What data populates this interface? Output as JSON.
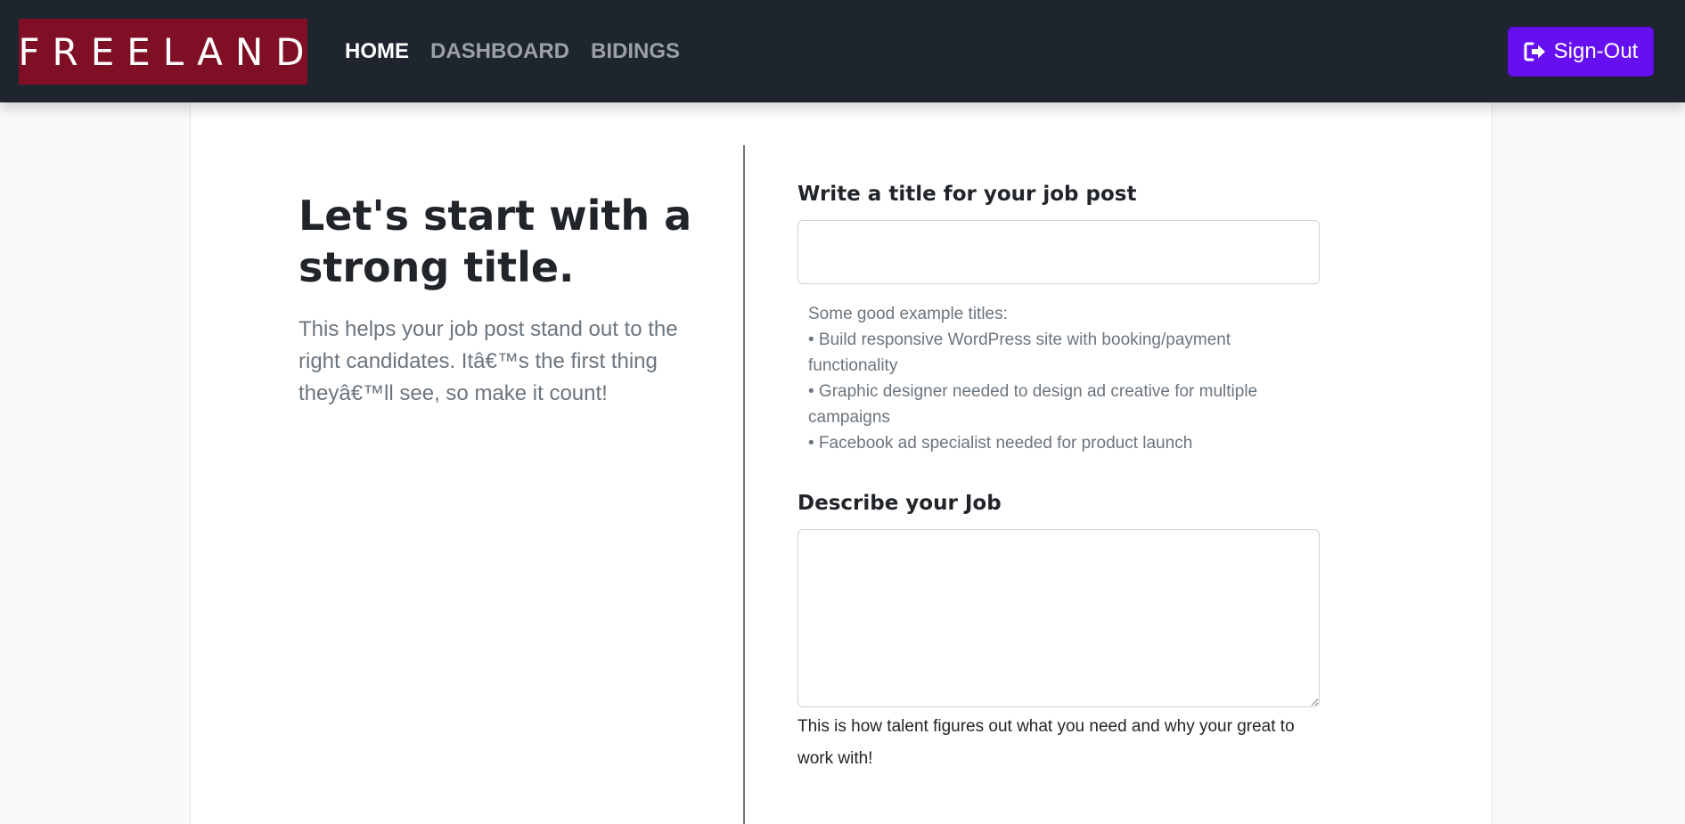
{
  "navbar": {
    "brand": "FREELAND",
    "links": [
      "HOME",
      "DASHBOARD",
      "BIDINGS"
    ],
    "signout_label": "Sign-Out",
    "colors": {
      "background": "#1e252e",
      "brand_bg": "#7f0f24",
      "signout_bg": "#6610f2"
    }
  },
  "intro": {
    "heading": "Let's start with a strong title.",
    "lead": "This helps your job post stand out to the right candidates. Itâ€™s the first thing theyâ€™ll see, so make it count!"
  },
  "form": {
    "title_label": "Write a title for your job post",
    "title_value": "",
    "examples_heading": "Some good example titles:",
    "examples": [
      "• Build responsive WordPress site with booking/payment functionality",
      "• Graphic designer needed to design ad creative for multiple campaigns",
      "• Facebook ad specialist needed for product launch"
    ],
    "description_label": "Describe your Job",
    "description_value": "",
    "description_help": "This is how talent figures out what you need and why your great to work with!"
  }
}
